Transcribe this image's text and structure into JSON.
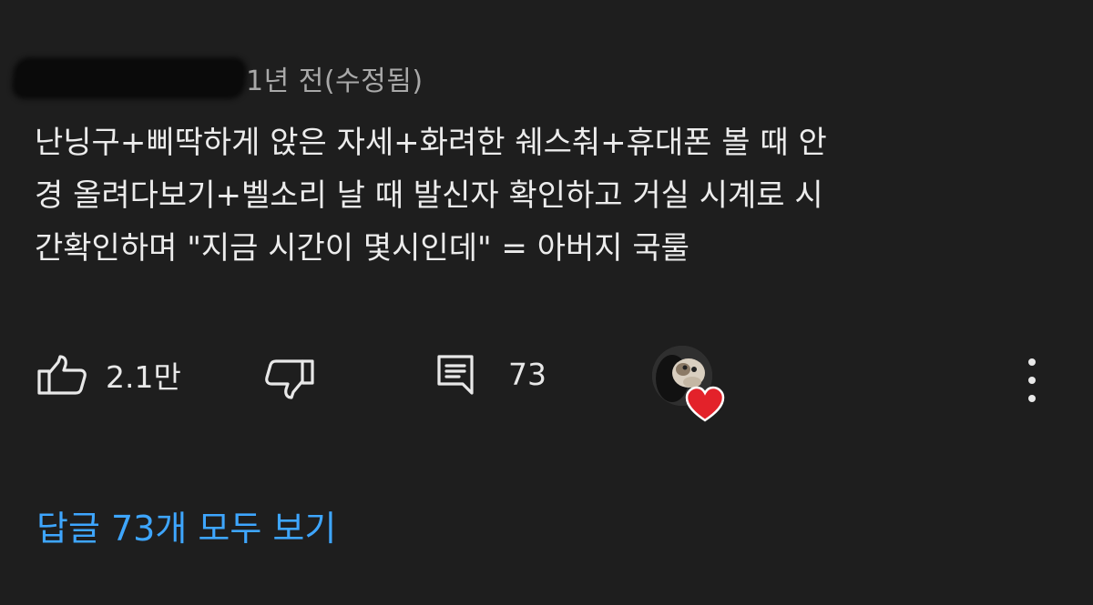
{
  "comment": {
    "author": "",
    "timestamp": "1년 전(수정됨)",
    "text": "난닝구+삐딱하게 앉은 자세+화려한 쉐스춰+휴대폰 볼 때 안\n경 올려다보기+벨소리 날 때 발신자 확인하고 거실 시계로 시\n간확인하며 \"지금 시간이 몇시인데\" = 아버지 국룰",
    "likes": "2.1만",
    "replies": "73",
    "view_replies_label": "답글 73개 모두 보기"
  },
  "icons": {
    "like": "thumbs-up-icon",
    "dislike": "thumbs-down-icon",
    "reply": "comment-icon",
    "creator_heart": "heart-icon",
    "more": "more-vert-icon"
  },
  "colors": {
    "background": "#1e1e1e",
    "text": "#ececec",
    "meta": "#a9a9a9",
    "link": "#3ea6ff",
    "heart": "#e3222a"
  }
}
